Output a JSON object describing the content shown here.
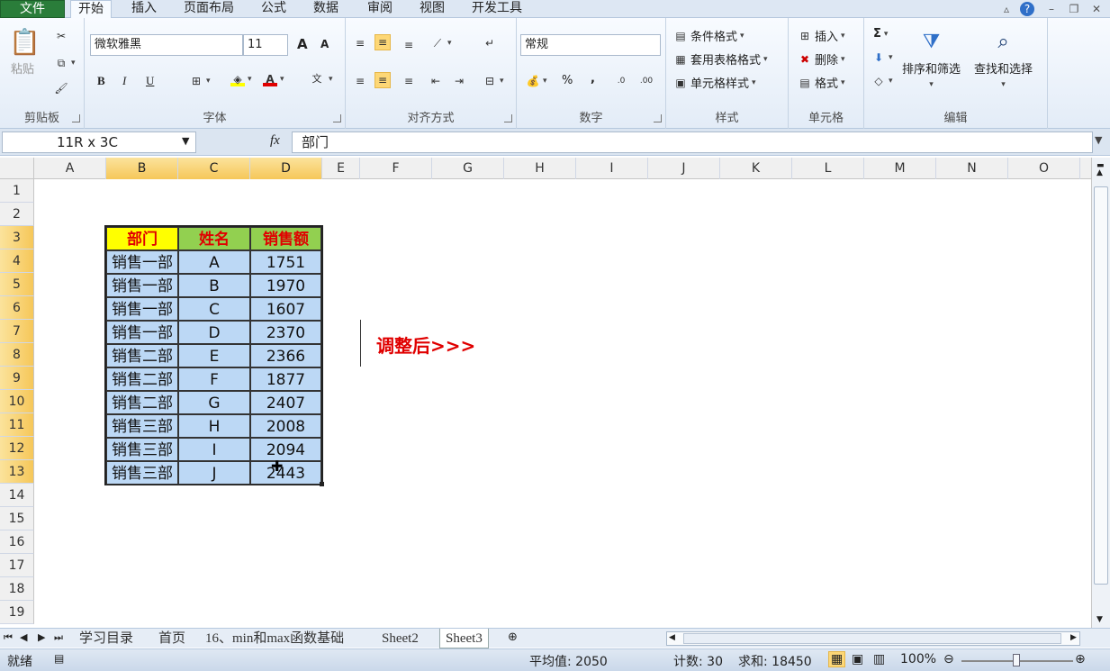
{
  "tabs": [
    "文件",
    "开始",
    "插入",
    "页面布局",
    "公式",
    "数据",
    "审阅",
    "视图",
    "开发工具"
  ],
  "clipboard": {
    "paste": "粘贴",
    "label": "剪贴板"
  },
  "font": {
    "name": "微软雅黑",
    "size": "11",
    "label": "字体",
    "bold": "B",
    "italic": "I",
    "underline": "U",
    "grow": "A",
    "shrink": "A"
  },
  "alignment": {
    "label": "对齐方式"
  },
  "number": {
    "format": "常规",
    "label": "数字",
    "percent": "%",
    "comma": ","
  },
  "styles": {
    "cond": "条件格式",
    "table": "套用表格格式",
    "cell": "单元格样式",
    "label": "样式"
  },
  "cells": {
    "insert": "插入",
    "delete": "删除",
    "format": "格式",
    "label": "单元格"
  },
  "editing": {
    "sort": "排序和筛选",
    "find": "查找和选择",
    "label": "编辑",
    "sum": "Σ"
  },
  "formula": {
    "namebox": "11R x 3C",
    "fx": "fx",
    "value": "部门"
  },
  "columns": [
    "A",
    "B",
    "C",
    "D",
    "E",
    "F",
    "G",
    "H",
    "I",
    "J",
    "K",
    "L",
    "M",
    "N",
    "O"
  ],
  "rows": [
    "1",
    "2",
    "3",
    "4",
    "5",
    "6",
    "7",
    "8",
    "9",
    "10",
    "11",
    "12",
    "13",
    "14",
    "15",
    "16",
    "17",
    "18",
    "19"
  ],
  "table": {
    "headers": [
      "部门",
      "姓名",
      "销售额"
    ],
    "rows": [
      [
        "销售一部",
        "A",
        "1751"
      ],
      [
        "销售一部",
        "B",
        "1970"
      ],
      [
        "销售一部",
        "C",
        "1607"
      ],
      [
        "销售一部",
        "D",
        "2370"
      ],
      [
        "销售二部",
        "E",
        "2366"
      ],
      [
        "销售二部",
        "F",
        "1877"
      ],
      [
        "销售二部",
        "G",
        "2407"
      ],
      [
        "销售三部",
        "H",
        "2008"
      ],
      [
        "销售三部",
        "I",
        "2094"
      ],
      [
        "销售三部",
        "J",
        "2443"
      ]
    ]
  },
  "annotation": "调整后>>>",
  "sheets": [
    "学习目录",
    "首页",
    "16、min和max函数基础",
    "Sheet2",
    "Sheet3"
  ],
  "status": {
    "ready": "就绪",
    "average": "平均值: 2050",
    "count": "计数: 30",
    "sum": "求和: 18450",
    "zoom": "100%"
  },
  "colors": {
    "header_yellow": "#ffff00",
    "header_green": "#92d050",
    "data_fill": "#bcd8f5",
    "header_text": "#e00000"
  }
}
